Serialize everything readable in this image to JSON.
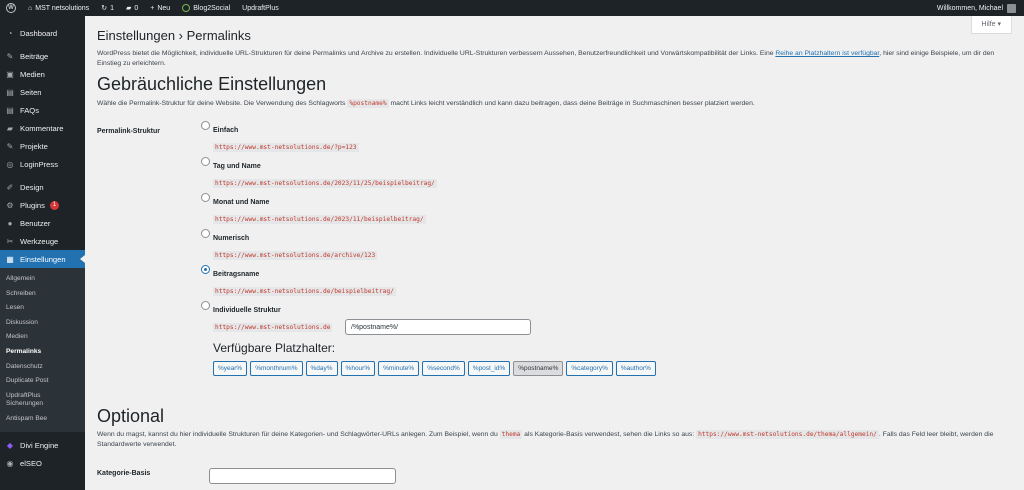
{
  "adminbar": {
    "site_name": "MST netsolutions",
    "updates_count": "1",
    "comments_count": "0",
    "new_label": "Neu",
    "blog2social_label": "Blog2Social",
    "updraftplus_label": "UpdraftPlus",
    "greeting": "Willkommen, Michael"
  },
  "sidebar": {
    "items": [
      {
        "label": "Dashboard",
        "icon": "dashboard-icon",
        "glyph": "◔"
      },
      {
        "label": "Beiträge",
        "icon": "pushpin-icon",
        "glyph": "✎"
      },
      {
        "label": "Medien",
        "icon": "media-icon",
        "glyph": "▣"
      },
      {
        "label": "Seiten",
        "icon": "page-icon",
        "glyph": "▤"
      },
      {
        "label": "FAQs",
        "icon": "faq-icon",
        "glyph": "▤"
      },
      {
        "label": "Kommentare",
        "icon": "comment-icon",
        "glyph": "▰"
      },
      {
        "label": "Projekte",
        "icon": "pushpin-icon",
        "glyph": "✎"
      },
      {
        "label": "LoginPress",
        "icon": "loginpress-icon",
        "glyph": "◎"
      },
      {
        "label": "Design",
        "icon": "brush-icon",
        "glyph": "✐"
      },
      {
        "label": "Plugins",
        "icon": "plugin-icon",
        "glyph": "⚙",
        "badge": "1"
      },
      {
        "label": "Benutzer",
        "icon": "user-icon",
        "glyph": "●"
      },
      {
        "label": "Werkzeuge",
        "icon": "wrench-icon",
        "glyph": "✂"
      },
      {
        "label": "Einstellungen",
        "icon": "settings-icon",
        "glyph": "▦"
      }
    ],
    "submenu": [
      "Allgemein",
      "Schreiben",
      "Lesen",
      "Diskussion",
      "Medien",
      "Permalinks",
      "Datenschutz",
      "Duplicate Post",
      "UpdraftPlus Sicherungen",
      "Antispam Bee"
    ],
    "bottom_items": [
      {
        "label": "Divi Engine",
        "icon": "divi-engine-icon",
        "glyph": "◆"
      },
      {
        "label": "elSEO",
        "icon": "elseo-icon",
        "glyph": "◉"
      }
    ]
  },
  "help_tab": "Hilfe ▾",
  "page_title": "Einstellungen › Permalinks",
  "intro": {
    "text_before": "WordPress bietet die Möglichkeit, individuelle URL-Strukturen für deine Permalinks und Archive zu erstellen. Individuelle URL-Strukturen verbessern Aussehen, Benutzerfreundlichkeit und Vorwärtskompatibilität der Links. Eine ",
    "link": "Reihe an Platzhaltern ist verfügbar",
    "text_after": ", hier sind einige Beispiele, um dir den Einstieg zu erleichtern."
  },
  "common": {
    "title": "Gebräuchliche Einstellungen",
    "desc_before": "Wähle die Permalink-Struktur für deine Website. Die Verwendung des Schlagworts ",
    "desc_code": "%postname%",
    "desc_after": " macht Links leicht verständlich und kann dazu beitragen, dass deine Beiträge in Suchmaschinen besser platziert werden."
  },
  "permalink_label": "Permalink-Struktur",
  "options": [
    {
      "label": "Einfach",
      "example": "https://www.mst-netsolutions.de/?p=123",
      "checked": false
    },
    {
      "label": "Tag und Name",
      "example": "https://www.mst-netsolutions.de/2023/11/25/beispielbeitrag/",
      "checked": false
    },
    {
      "label": "Monat und Name",
      "example": "https://www.mst-netsolutions.de/2023/11/beispielbeitrag/",
      "checked": false
    },
    {
      "label": "Numerisch",
      "example": "https://www.mst-netsolutions.de/archive/123",
      "checked": false
    },
    {
      "label": "Beitragsname",
      "example": "https://www.mst-netsolutions.de/beispielbeitrag/",
      "checked": true
    },
    {
      "label": "Individuelle Struktur",
      "example": "https://www.mst-netsolutions.de",
      "checked": false
    }
  ],
  "custom_structure_value": "/%postname%/",
  "available_tags_title": "Verfügbare Platzhalter:",
  "tags": [
    "%year%",
    "%monthnum%",
    "%day%",
    "%hour%",
    "%minute%",
    "%second%",
    "%post_id%",
    "%postname%",
    "%category%",
    "%author%"
  ],
  "active_tag": "%postname%",
  "optional": {
    "title": "Optional",
    "desc_before": "Wenn du magst, kannst du hier individuelle Strukturen für deine Kategorien- und Schlagwörter-URLs anlegen. Zum Beispiel, wenn du ",
    "desc_code1": "thema",
    "desc_mid": " als Kategorie-Basis verwendest, sehen die Links so aus: ",
    "desc_code2": "https://www.mst-netsolutions.de/thema/allgemein/",
    "desc_after": ". Falls das Feld leer bleibt, werden die Standardwerte verwendet.",
    "category_base_label": "Kategorie-Basis"
  }
}
